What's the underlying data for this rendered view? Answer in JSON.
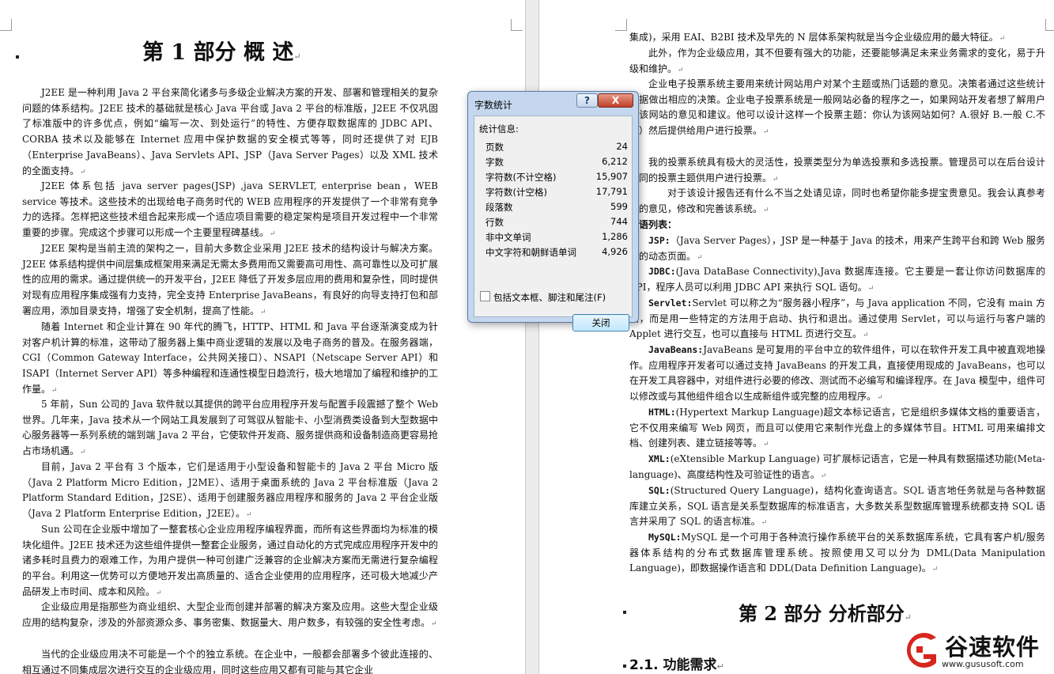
{
  "left_page": {
    "heading": "第 1 部分   概   述",
    "paragraphs": [
      "J2EE 是一种利用 Java 2 平台来简化诸多与多级企业解决方案的开发、部署和管理相关的复杂问题的体系结构。J2EE 技术的基础就是核心 Java 平台或 Java 2 平台的标准版，J2EE 不仅巩固了标准版中的许多优点，例如“编写一次、到处运行”的特性、方便存取数据库的 JDBC API、CORBA 技术以及能够在 Internet 应用中保护数据的安全模式等等，同时还提供了对 EJB（Enterprise JavaBeans）、Java Servlets API、JSP（Java Server Pages）以及 XML 技术的全面支持。",
      "J2EE 体系包括 java server pages(JSP) ,java SERVLET, enterprise bean，WEB service 等技术。这些技术的出现给电子商务时代的 WEB 应用程序的开发提供了一个非常有竞争力的选择。怎样把这些技术组合起来形成一个适应项目需要的稳定架构是项目开发过程中一个非常重要的步骤。完成这个步骤可以形成一个主要里程碑基线。",
      "J2EE 架构是当前主流的架构之一，目前大多数企业采用 J2EE 技术的结构设计与解决方案。J2EE 体系结构提供中间层集成框架用来满足无需太多费用而又需要高可用性、高可靠性以及可扩展性的应用的需求。通过提供统一的开发平台，J2EE 降低了开发多层应用的费用和复杂性，同时提供对现有应用程序集成强有力支持，完全支持 Enterprise JavaBeans，有良好的向导支持打包和部署应用，添加目录支持，增强了安全机制，提高了性能。",
      "随着 Internet 和企业计算在 90 年代的腾飞，HTTP、HTML 和 Java 平台逐渐演变成为针对客户机计算的标准，这带动了服务器上集中商业逻辑的发展以及电子商务的普及。在服务器端，CGI（Common Gateway Interface，公共网关接口）、NSAPI（Netscape Server API）和 ISAPI（Internet Server API）等多种编程和连通性模型日趋流行，极大地增加了编程和维护的工作量。",
      "5 年前，Sun 公司的 Java 软件就以其提供的跨平台应用程序开发与配置手段震撼了整个 Web 世界。几年来，Java 技术从一个网站工具发展到了可驾驭从智能卡、小型消费类设备到大型数据中心服务器等一系列系统的端到端 Java 2 平台，它使软件开发商、服务提供商和设备制造商更容易抢占市场机遇。",
      "目前，Java 2 平台有 3 个版本，它们是适用于小型设备和智能卡的 Java 2 平台 Micro 版（Java 2 Platform Micro Edition，J2ME）、适用于桌面系统的 Java 2 平台标准版（Java 2 Platform Standard Edition，J2SE）、适用于创建服务器应用程序和服务的 Java 2 平台企业版（Java 2 Platform Enterprise Edition，J2EE）。",
      "Sun 公司在企业版中增加了一整套核心企业应用程序编程界面，而所有这些界面均为标准的模块化组件。J2EE 技术还为这些组件提供一整套企业服务，通过自动化的方式完成应用程序开发中的诸多耗时且费力的艰难工作，为用户提供一种可创建广泛兼容的企业解决方案而无需进行复杂编程的平台。利用这一优势可以方便地开发出高质量的、适合企业使用的应用程序，还可极大地减少产品研发上市时间、成本和风险。",
      "企业级应用是指那些为商业组织、大型企业而创建并部署的解决方案及应用。这些大型企业级应用的结构复杂，涉及的外部资源众多、事务密集、数据量大、用户数多，有较强的安全性考虑。",
      "当代的企业级应用决不可能是一个个的独立系统。在企业中，一般都会部署多个彼此连接的、相互通过不同集成层次进行交互的企业级应用，同时这些应用又都有可能与其它企业"
    ]
  },
  "right_page": {
    "paragraphs": [
      "集成)，采用 EAI、B2BI 技术及早先的 N 层体系架构就是当今企业级应用的最大特征。",
      "此外，作为企业级应用，其不但要有强大的功能，还要能够满足未来业务需求的变化，易于升级和维护。",
      "企业电子投票系统主要用来统计网站用户对某个主题或热门话题的意见。决策者通过这些统计数据做出相应的决策。企业电子投票系统是一般网站必备的程序之一，如果网站开发者想了解用户对该网站的意见和建议。他可以设计这样一个投票主题：你认为该网站如何？A.很好 B.一般 C.不好）然后提供给用户进行投票。",
      "我的投票系统具有极大的灵活性，投票类型分为单选投票和多选投票。管理员可以在后台设计不同的投票主题供用户进行投票。",
      "对于该设计报告还有什么不当之处请见谅，同时也希望你能多提宝贵意见。我会认真参考您的意见，修改和完善该系统。"
    ],
    "term_list_title": "术语列表：",
    "terms": [
      {
        "term": "JSP:",
        "def": "（Java Server Pages），JSP 是一种基于 Java 的技术，用来产生跨平台和跨 Web 服务器的动态页面。"
      },
      {
        "term": "JDBC:",
        "def": "(Java DataBase Connectivity),Java 数据库连接。它主要是一套让你访问数据库的 API，程序人员可以利用 JDBC API 来执行 SQL 语句。"
      },
      {
        "term": "Servlet:",
        "def": "Servlet 可以称之为“服务器小程序”，与 Java application 不同，它没有 main 方法，而是用一些特定的方法用于启动、执行和退出。通过使用 Servlet，可以与运行与客户端的 Applet 进行交互，也可以直接与 HTML 页进行交互。"
      },
      {
        "term": "JavaBeans:",
        "def": "JavaBeans 是可复用的平台中立的软件组件，可以在软件开发工具中被直观地操作。应用程序开发者可以通过支持 JavaBeans 的开发工具，直接使用现成的 JavaBeans，也可以在开发工具容器中，对组件进行必要的修改、测试而不必编写和编译程序。在 Java 模型中，组件可以修改或与其他组件组合以生成新组件或完整的应用程序。"
      },
      {
        "term": "HTML:",
        "def": "(Hypertext Markup Language)超文本标记语言，它是组织多媒体文档的重要语言，它不仅用来编写 Web 网页，而且可以使用它来制作光盘上的多媒体节目。HTML 可用来编排文档、创建列表、建立链接等等。"
      },
      {
        "term": "XML:",
        "def": "(eXtensible Markup Language) 可扩展标记语言，它是一种具有数据描述功能(Meta-language)、高度结构性及可验证性的语言。"
      },
      {
        "term": "SQL:",
        "def": "(Structured Query Language)，结构化查询语言。SQL 语言地任务就是与各种数据库建立关系，SQL 语言是关系型数据库的标准语言，大多数关系型数据库管理系统都支持 SQL 语言并采用了 SQL 的语言标准。"
      },
      {
        "term": "MySQL:",
        "def": "MySQL 是一个可用于各种流行操作系统平台的关系数据库系统，它具有客户机/服务器体系结构的分布式数据库管理系统。按照使用又可以分为 DML(Data Manipulation Language)，即数据操作语言和 DDL(Data Definition Language)。"
      }
    ],
    "heading2": "第 2 部分   分析部分",
    "heading3": "2.1. 功能需求"
  },
  "dialog": {
    "title": "字数统计",
    "help_label": "?",
    "close_x_label": "X",
    "group_label": "统计信息:",
    "stats": [
      {
        "label": "页数",
        "value": "24"
      },
      {
        "label": "字数",
        "value": "6,212"
      },
      {
        "label": "字符数(不计空格)",
        "value": "15,907"
      },
      {
        "label": "字符数(计空格)",
        "value": "17,791"
      },
      {
        "label": "段落数",
        "value": "599"
      },
      {
        "label": "行数",
        "value": "744"
      },
      {
        "label": "非中文单词",
        "value": "1,286"
      },
      {
        "label": "中文字符和朝鲜语单词",
        "value": "4,926"
      }
    ],
    "checkbox_label": "包括文本框、脚注和尾注(F)",
    "checkbox_checked": false,
    "close_button_label": "关闭"
  },
  "watermark": {
    "name": "谷速软件",
    "url": "www.gususoft.com",
    "color": "#d7261e"
  }
}
